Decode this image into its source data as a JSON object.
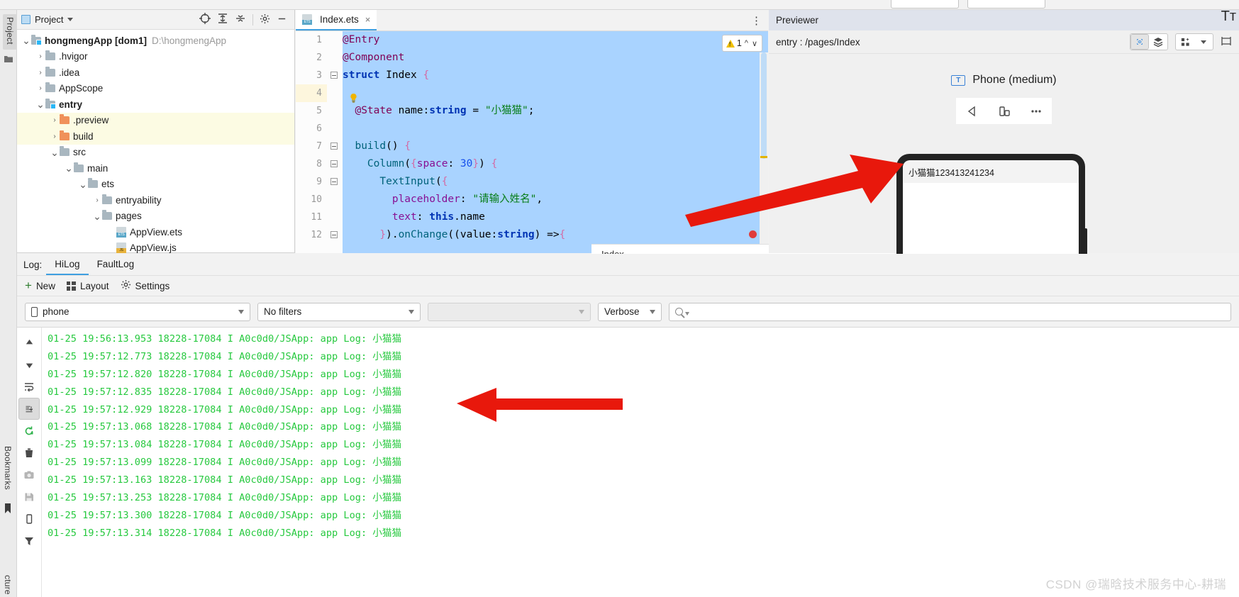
{
  "project_panel": {
    "title": "Project",
    "toolbar_icons": [
      "target-icon",
      "expand-all-icon",
      "collapse-all-icon",
      "gear-icon",
      "minimize-icon"
    ],
    "tree": [
      {
        "label": "hongmengApp [dom1]",
        "path": "D:\\hongmengApp",
        "indent": 0,
        "arrow": "v",
        "icon": "module-folder",
        "bold": true,
        "highlight": false
      },
      {
        "label": ".hvigor",
        "path": "",
        "indent": 1,
        "arrow": ">",
        "icon": "folder",
        "bold": false,
        "highlight": false
      },
      {
        "label": ".idea",
        "path": "",
        "indent": 1,
        "arrow": ">",
        "icon": "folder",
        "bold": false,
        "highlight": false
      },
      {
        "label": "AppScope",
        "path": "",
        "indent": 1,
        "arrow": ">",
        "icon": "folder",
        "bold": false,
        "highlight": false
      },
      {
        "label": "entry",
        "path": "",
        "indent": 1,
        "arrow": "v",
        "icon": "module-folder",
        "bold": true,
        "highlight": false
      },
      {
        "label": ".preview",
        "path": "",
        "indent": 2,
        "arrow": ">",
        "icon": "folder-orange",
        "bold": false,
        "highlight": true
      },
      {
        "label": "build",
        "path": "",
        "indent": 2,
        "arrow": ">",
        "icon": "folder-orange",
        "bold": false,
        "highlight": true
      },
      {
        "label": "src",
        "path": "",
        "indent": 2,
        "arrow": "v",
        "icon": "folder",
        "bold": false,
        "highlight": false
      },
      {
        "label": "main",
        "path": "",
        "indent": 3,
        "arrow": "v",
        "icon": "folder",
        "bold": false,
        "highlight": false
      },
      {
        "label": "ets",
        "path": "",
        "indent": 4,
        "arrow": "v",
        "icon": "folder",
        "bold": false,
        "highlight": false
      },
      {
        "label": "entryability",
        "path": "",
        "indent": 5,
        "arrow": ">",
        "icon": "folder",
        "bold": false,
        "highlight": false
      },
      {
        "label": "pages",
        "path": "",
        "indent": 5,
        "arrow": "v",
        "icon": "folder",
        "bold": false,
        "highlight": false
      },
      {
        "label": "AppView.ets",
        "path": "",
        "indent": 6,
        "arrow": "",
        "icon": "ets-file",
        "bold": false,
        "highlight": false
      },
      {
        "label": "AppView.js",
        "path": "",
        "indent": 6,
        "arrow": "",
        "icon": "js-file",
        "bold": false,
        "highlight": false
      }
    ]
  },
  "editor": {
    "tab_label": "Index.ets",
    "tab_close": "×",
    "more_icon": "⋮",
    "warning_count": "1",
    "breadcrumb": "Index",
    "lines": [
      {
        "n": "1",
        "fold": false,
        "tokens": [
          {
            "t": "@Entry",
            "c": "k-dec"
          }
        ]
      },
      {
        "n": "2",
        "fold": false,
        "tokens": [
          {
            "t": "@Component",
            "c": "k-dec"
          }
        ]
      },
      {
        "n": "3",
        "fold": true,
        "tokens": [
          {
            "t": "struct",
            "c": "k-kw"
          },
          {
            "t": " Index ",
            "c": "k-id"
          },
          {
            "t": "{",
            "c": "k-br"
          }
        ]
      },
      {
        "n": "4",
        "fold": false,
        "current": true,
        "tokens": []
      },
      {
        "n": "5",
        "fold": false,
        "tokens": [
          {
            "t": "  @State",
            "c": "k-dec"
          },
          {
            "t": " name",
            "c": "k-id"
          },
          {
            "t": ":",
            "c": "k-pl"
          },
          {
            "t": "string",
            "c": "k-type"
          },
          {
            "t": " = ",
            "c": "k-pl"
          },
          {
            "t": "\"小猫猫\"",
            "c": "k-str"
          },
          {
            "t": ";",
            "c": "k-pl"
          }
        ]
      },
      {
        "n": "6",
        "fold": false,
        "tokens": []
      },
      {
        "n": "7",
        "fold": true,
        "tokens": [
          {
            "t": "  build",
            "c": "k-fn"
          },
          {
            "t": "() ",
            "c": "k-pl"
          },
          {
            "t": "{",
            "c": "k-br"
          }
        ]
      },
      {
        "n": "8",
        "fold": true,
        "tokens": [
          {
            "t": "    Column",
            "c": "k-fn"
          },
          {
            "t": "(",
            "c": "k-pl"
          },
          {
            "t": "{",
            "c": "k-br"
          },
          {
            "t": "space",
            "c": "k-prop"
          },
          {
            "t": ": ",
            "c": "k-pl"
          },
          {
            "t": "30",
            "c": "k-num"
          },
          {
            "t": "}",
            "c": "k-br"
          },
          {
            "t": ") ",
            "c": "k-pl"
          },
          {
            "t": "{",
            "c": "k-br"
          }
        ]
      },
      {
        "n": "9",
        "fold": true,
        "tokens": [
          {
            "t": "      TextInput",
            "c": "k-fn"
          },
          {
            "t": "(",
            "c": "k-pl"
          },
          {
            "t": "{",
            "c": "k-br"
          }
        ]
      },
      {
        "n": "10",
        "fold": false,
        "tokens": [
          {
            "t": "        placeholder",
            "c": "k-prop"
          },
          {
            "t": ": ",
            "c": "k-pl"
          },
          {
            "t": "\"请输入姓名\"",
            "c": "k-str"
          },
          {
            "t": ",",
            "c": "k-pl"
          }
        ]
      },
      {
        "n": "11",
        "fold": false,
        "tokens": [
          {
            "t": "        text",
            "c": "k-prop"
          },
          {
            "t": ": ",
            "c": "k-pl"
          },
          {
            "t": "this",
            "c": "k-kw"
          },
          {
            "t": ".name",
            "c": "k-id"
          }
        ]
      },
      {
        "n": "12",
        "fold": true,
        "tokens": [
          {
            "t": "      }",
            "c": "k-br"
          },
          {
            "t": ").",
            "c": "k-pl"
          },
          {
            "t": "onChange",
            "c": "k-fn"
          },
          {
            "t": "((",
            "c": "k-pl"
          },
          {
            "t": "value",
            "c": "k-id"
          },
          {
            "t": ":",
            "c": "k-pl"
          },
          {
            "t": "string",
            "c": "k-type"
          },
          {
            "t": ") =>",
            "c": "k-pl"
          },
          {
            "t": "{",
            "c": "k-br"
          }
        ]
      }
    ]
  },
  "previewer": {
    "title": "Previewer",
    "tt_glyph": "Tᴛ",
    "route": "entry : /pages/Index",
    "device_label": "Phone (medium)",
    "device_badge": "T",
    "control_icons": [
      "back-triangle-icon",
      "rotate-device-icon",
      "more-dots-icon"
    ],
    "toolbar_icons": [
      "inspector-eye-icon",
      "layers-icon",
      "grid-layout-icon",
      "chevron-down-icon",
      "frame-icon"
    ],
    "phone_input_text": "小猫猫123413241234"
  },
  "log": {
    "label": "Log:",
    "tabs": [
      {
        "label": "HiLog",
        "active": true
      },
      {
        "label": "FaultLog",
        "active": false
      }
    ],
    "actions": [
      {
        "label": "New",
        "icon": "plus-icon"
      },
      {
        "label": "Layout",
        "icon": "layout-grid-icon"
      },
      {
        "label": "Settings",
        "icon": "gear-icon"
      }
    ],
    "filters": {
      "device": "phone",
      "filter": "No filters",
      "process": "",
      "level": "Verbose",
      "search_placeholder": ""
    },
    "rail_icons": [
      "scroll-up-icon",
      "scroll-down-icon",
      "soft-wrap-icon",
      "scroll-to-end-icon",
      "restart-icon",
      "clear-icon",
      "screenshot-icon",
      "save-icon",
      "device-icon",
      "filter-icon"
    ],
    "lines": [
      "01-25 19:56:13.953 18228-17084 I A0c0d0/JSApp: app Log: 小猫猫",
      "01-25 19:57:12.773 18228-17084 I A0c0d0/JSApp: app Log: 小猫猫",
      "01-25 19:57:12.820 18228-17084 I A0c0d0/JSApp: app Log: 小猫猫",
      "01-25 19:57:12.835 18228-17084 I A0c0d0/JSApp: app Log: 小猫猫",
      "01-25 19:57:12.929 18228-17084 I A0c0d0/JSApp: app Log: 小猫猫",
      "01-25 19:57:13.068 18228-17084 I A0c0d0/JSApp: app Log: 小猫猫",
      "01-25 19:57:13.084 18228-17084 I A0c0d0/JSApp: app Log: 小猫猫",
      "01-25 19:57:13.099 18228-17084 I A0c0d0/JSApp: app Log: 小猫猫",
      "01-25 19:57:13.163 18228-17084 I A0c0d0/JSApp: app Log: 小猫猫",
      "01-25 19:57:13.253 18228-17084 I A0c0d0/JSApp: app Log: 小猫猫",
      "01-25 19:57:13.300 18228-17084 I A0c0d0/JSApp: app Log: 小猫猫",
      "01-25 19:57:13.314 18228-17084 I A0c0d0/JSApp: app Log: 小猫猫"
    ]
  },
  "rail": {
    "project_label": "Project",
    "bookmarks_label": "Bookmarks",
    "structure_label": "cture"
  },
  "watermark": "CSDN @瑞晗技术服务中心-耕瑞",
  "colors": {
    "log_green": "#27c93f",
    "selection_blue": "#a9d3ff",
    "accent_blue": "#3f9fe0",
    "arrow_red": "#e8180c",
    "highlight_yellow": "#fcfbe3"
  }
}
